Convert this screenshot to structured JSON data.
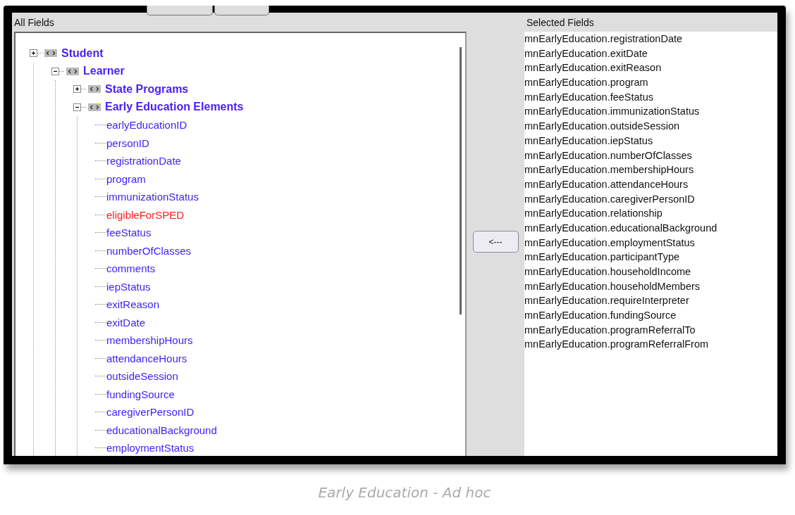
{
  "all_fields": {
    "title": "All Fields",
    "tree": [
      {
        "label": "Student",
        "expanded": false,
        "children": [
          {
            "label": "Learner",
            "expanded": true,
            "children": [
              {
                "label": "State Programs",
                "expanded": false
              },
              {
                "label": "Early Education Elements",
                "expanded": true,
                "fields": [
                  {
                    "label": "earlyEducationID",
                    "color": "#3a1eff"
                  },
                  {
                    "label": "personID",
                    "color": "#3a1eff"
                  },
                  {
                    "label": "registrationDate",
                    "color": "#3a1eff"
                  },
                  {
                    "label": "program",
                    "color": "#3a1eff"
                  },
                  {
                    "label": "immunizationStatus",
                    "color": "#3a1eff"
                  },
                  {
                    "label": "eligibleForSPED",
                    "color": "#ff1a1a"
                  },
                  {
                    "label": "feeStatus",
                    "color": "#3a1eff"
                  },
                  {
                    "label": "numberOfClasses",
                    "color": "#3a1eff"
                  },
                  {
                    "label": "comments",
                    "color": "#3a1eff"
                  },
                  {
                    "label": "iepStatus",
                    "color": "#3a1eff"
                  },
                  {
                    "label": "exitReason",
                    "color": "#3a1eff"
                  },
                  {
                    "label": "exitDate",
                    "color": "#3a1eff"
                  },
                  {
                    "label": "membershipHours",
                    "color": "#3a1eff"
                  },
                  {
                    "label": "attendanceHours",
                    "color": "#3a1eff"
                  },
                  {
                    "label": "outsideSession",
                    "color": "#3a1eff"
                  },
                  {
                    "label": "fundingSource",
                    "color": "#3a1eff"
                  },
                  {
                    "label": "caregiverPersonID",
                    "color": "#3a1eff"
                  },
                  {
                    "label": "educationalBackground",
                    "color": "#3a1eff"
                  },
                  {
                    "label": "employmentStatus",
                    "color": "#3a1eff"
                  }
                ]
              }
            ]
          }
        ]
      }
    ]
  },
  "remove_button": {
    "label": "<---"
  },
  "selected_fields": {
    "title": "Selected Fields",
    "items": [
      "mnEarlyEducation.registrationDate",
      "mnEarlyEducation.exitDate",
      "mnEarlyEducation.exitReason",
      "mnEarlyEducation.program",
      "mnEarlyEducation.feeStatus",
      "mnEarlyEducation.immunizationStatus",
      "mnEarlyEducation.outsideSession",
      "mnEarlyEducation.iepStatus",
      "mnEarlyEducation.numberOfClasses",
      "mnEarlyEducation.membershipHours",
      "mnEarlyEducation.attendanceHours",
      "mnEarlyEducation.caregiverPersonID",
      "mnEarlyEducation.relationship",
      "mnEarlyEducation.educationalBackground",
      "mnEarlyEducation.employmentStatus",
      "mnEarlyEducation.participantType",
      "mnEarlyEducation.householdIncome",
      "mnEarlyEducation.householdMembers",
      "mnEarlyEducation.requireInterpreter",
      "mnEarlyEducation.fundingSource",
      "mnEarlyEducation.programReferralTo",
      "mnEarlyEducation.programReferralFrom"
    ]
  },
  "caption": "Early Education - Ad hoc"
}
